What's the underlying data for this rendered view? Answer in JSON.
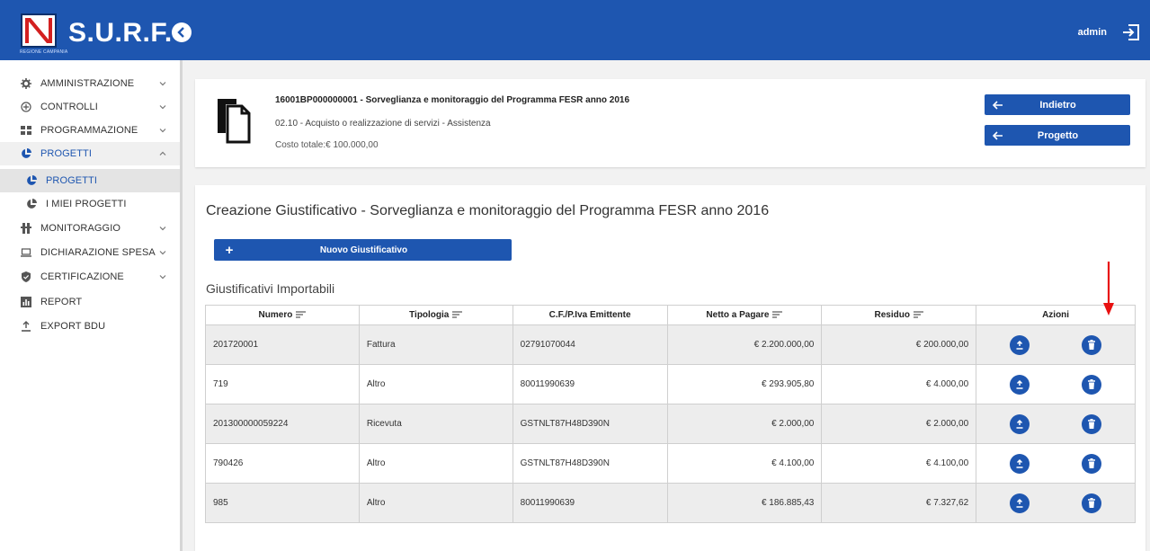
{
  "app": {
    "brand": "S.U.R.F.",
    "logo_caption": "REGIONE CAMPANIA",
    "user": "admin"
  },
  "sidebar": {
    "items": [
      {
        "label": "AMMINISTRAZIONE",
        "icon": "gear-icon"
      },
      {
        "label": "CONTROLLI",
        "icon": "plus-circle-icon"
      },
      {
        "label": "PROGRAMMAZIONE",
        "icon": "grid-icon"
      },
      {
        "label": "PROGETTI",
        "icon": "pie-icon"
      },
      {
        "label": "PROGETTI",
        "icon": "pie-icon"
      },
      {
        "label": "I MIEI PROGETTI",
        "icon": "pie-icon"
      },
      {
        "label": "MONITORAGGIO",
        "icon": "monitor-icon"
      },
      {
        "label": "DICHIARAZIONE SPESA",
        "icon": "laptop-icon"
      },
      {
        "label": "CERTIFICAZIONE",
        "icon": "shield-icon"
      },
      {
        "label": "REPORT",
        "icon": "report-icon"
      },
      {
        "label": "EXPORT BDU",
        "icon": "export-icon"
      }
    ]
  },
  "project": {
    "title": "16001BP000000001 - Sorveglianza e monitoraggio del Programma FESR anno 2016",
    "subtitle": "02.10 - Acquisto o realizzazione di servizi - Assistenza",
    "cost": "Costo totale:€ 100.000,00",
    "back_label": "Indietro",
    "project_label": "Progetto"
  },
  "main": {
    "title": "Creazione Giustificativo - Sorveglianza e monitoraggio del Programma FESR anno 2016",
    "new_button": "Nuovo Giustificativo",
    "section_title": "Giustificativi Importabili"
  },
  "table": {
    "headers": [
      "Numero",
      "Tipologia",
      "C.F./P.Iva Emittente",
      "Netto a Pagare",
      "Residuo",
      "Azioni"
    ],
    "rows": [
      [
        "201720001",
        "Fattura",
        "02791070044",
        "€ 2.200.000,00",
        "€ 200.000,00"
      ],
      [
        "719",
        "Altro",
        "80011990639",
        "€ 293.905,80",
        "€ 4.000,00"
      ],
      [
        "201300000059224",
        "Ricevuta",
        "GSTNLT87H48D390N",
        "€ 2.000,00",
        "€ 2.000,00"
      ],
      [
        "790426",
        "Altro",
        "GSTNLT87H48D390N",
        "€ 4.100,00",
        "€ 4.100,00"
      ],
      [
        "985",
        "Altro",
        "80011990639",
        "€ 186.885,43",
        "€ 7.327,62"
      ]
    ]
  },
  "colors": {
    "primary": "#1e56b0",
    "annotation": "#e81010"
  }
}
